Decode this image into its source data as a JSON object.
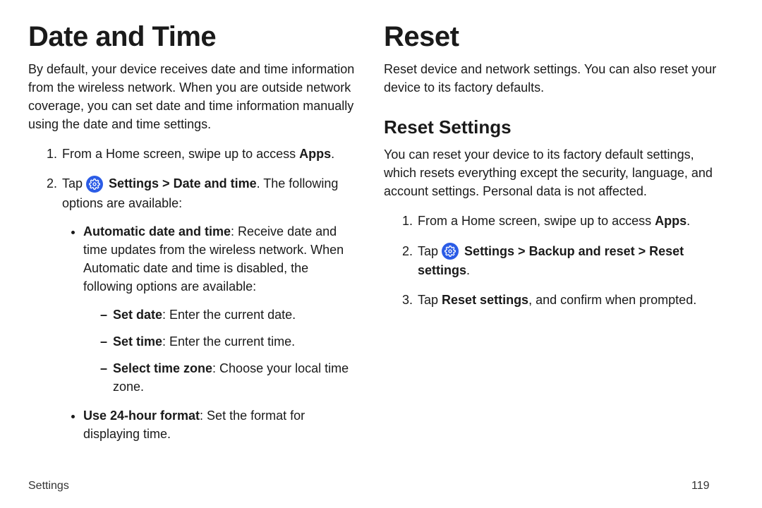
{
  "left": {
    "heading": "Date and Time",
    "intro": "By default, your device receives date and time information from the wireless network. When you are outside network coverage, you can set date and time information manually using the date and time settings.",
    "step1_pre": "From a Home screen, swipe up to access ",
    "step1_bold": "Apps",
    "step1_post": ".",
    "step2_pre": "Tap ",
    "step2_bold": "Settings > Date and time",
    "step2_post": ". The following options are available:",
    "bullet1_bold": "Automatic date and time",
    "bullet1_rest": ": Receive date and time updates from the wireless network. When Automatic date and time is disabled, the following options are available:",
    "dash1_bold": "Set date",
    "dash1_rest": ": Enter the current date.",
    "dash2_bold": "Set time",
    "dash2_rest": ": Enter the current time.",
    "dash3_bold": "Select time zone",
    "dash3_rest": ": Choose your local time zone.",
    "bullet2_bold": "Use 24-hour format",
    "bullet2_rest": ": Set the format for displaying time."
  },
  "right": {
    "heading": "Reset",
    "intro": "Reset device and network settings. You can also reset your device to its factory defaults.",
    "sub": "Reset Settings",
    "sub_intro": "You can reset your device to its factory default settings, which resets everything except the security, language, and account settings. Personal data is not affected.",
    "step1_pre": "From a Home screen, swipe up to access ",
    "step1_bold": "Apps",
    "step1_post": ".",
    "step2_pre": "Tap ",
    "step2_bold": "Settings > Backup and reset > Reset settings",
    "step2_post": ".",
    "step3_pre": "Tap ",
    "step3_bold": "Reset settings",
    "step3_post": ", and confirm when prompted."
  },
  "footer": {
    "section": "Settings",
    "page": "119"
  }
}
